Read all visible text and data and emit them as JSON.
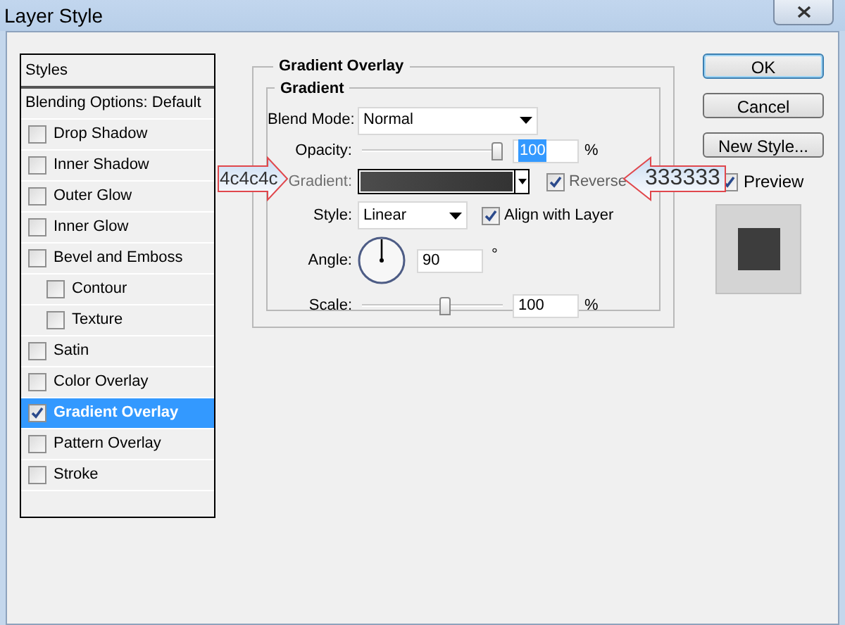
{
  "window": {
    "title": "Layer Style"
  },
  "styles_panel": {
    "header": "Styles",
    "items": [
      {
        "kind": "plain",
        "label": "Blending Options: Default",
        "selected": false
      },
      {
        "kind": "checkbox",
        "label": "Drop Shadow",
        "checked": false,
        "selected": false
      },
      {
        "kind": "checkbox",
        "label": "Inner Shadow",
        "checked": false,
        "selected": false
      },
      {
        "kind": "checkbox",
        "label": "Outer Glow",
        "checked": false,
        "selected": false
      },
      {
        "kind": "checkbox",
        "label": "Inner Glow",
        "checked": false,
        "selected": false
      },
      {
        "kind": "checkbox",
        "label": "Bevel and Emboss",
        "checked": false,
        "selected": false,
        "children": [
          {
            "kind": "checkbox",
            "label": "Contour",
            "checked": false,
            "selected": false
          },
          {
            "kind": "checkbox",
            "label": "Texture",
            "checked": false,
            "selected": false
          }
        ]
      },
      {
        "kind": "checkbox",
        "label": "Satin",
        "checked": false,
        "selected": false
      },
      {
        "kind": "checkbox",
        "label": "Color Overlay",
        "checked": false,
        "selected": false
      },
      {
        "kind": "checkbox",
        "label": "Gradient Overlay",
        "checked": true,
        "selected": true
      },
      {
        "kind": "checkbox",
        "label": "Pattern Overlay",
        "checked": false,
        "selected": false
      },
      {
        "kind": "checkbox",
        "label": "Stroke",
        "checked": false,
        "selected": false
      }
    ]
  },
  "gradient_overlay": {
    "title": "Gradient Overlay",
    "group_title": "Gradient",
    "blend_mode": {
      "label": "Blend Mode:",
      "value": "Normal"
    },
    "opacity": {
      "label": "Opacity:",
      "level": 1,
      "value": "100",
      "unit": "%"
    },
    "gradient": {
      "label": "Gradient:",
      "reverse": {
        "label": "Reverse",
        "checked": true
      }
    },
    "style": {
      "label": "Style:",
      "value": "Linear",
      "align": {
        "label": "Align with Layer",
        "checked": true
      }
    },
    "angle": {
      "label": "Angle:",
      "value": "90",
      "unit": "°"
    },
    "scale": {
      "label": "Scale:",
      "level": 0.6,
      "value": "100",
      "unit": "%"
    }
  },
  "buttons": [
    {
      "label": "OK",
      "default": true
    },
    {
      "label": "Cancel",
      "default": false
    },
    {
      "label": "New Style...",
      "default": false
    }
  ],
  "preview": {
    "label": "Preview",
    "checked": true
  },
  "annotations": [
    {
      "text": "4c4c4c",
      "kind": "rightarrow"
    },
    {
      "text": "333333",
      "kind": "leftarrow"
    }
  ]
}
